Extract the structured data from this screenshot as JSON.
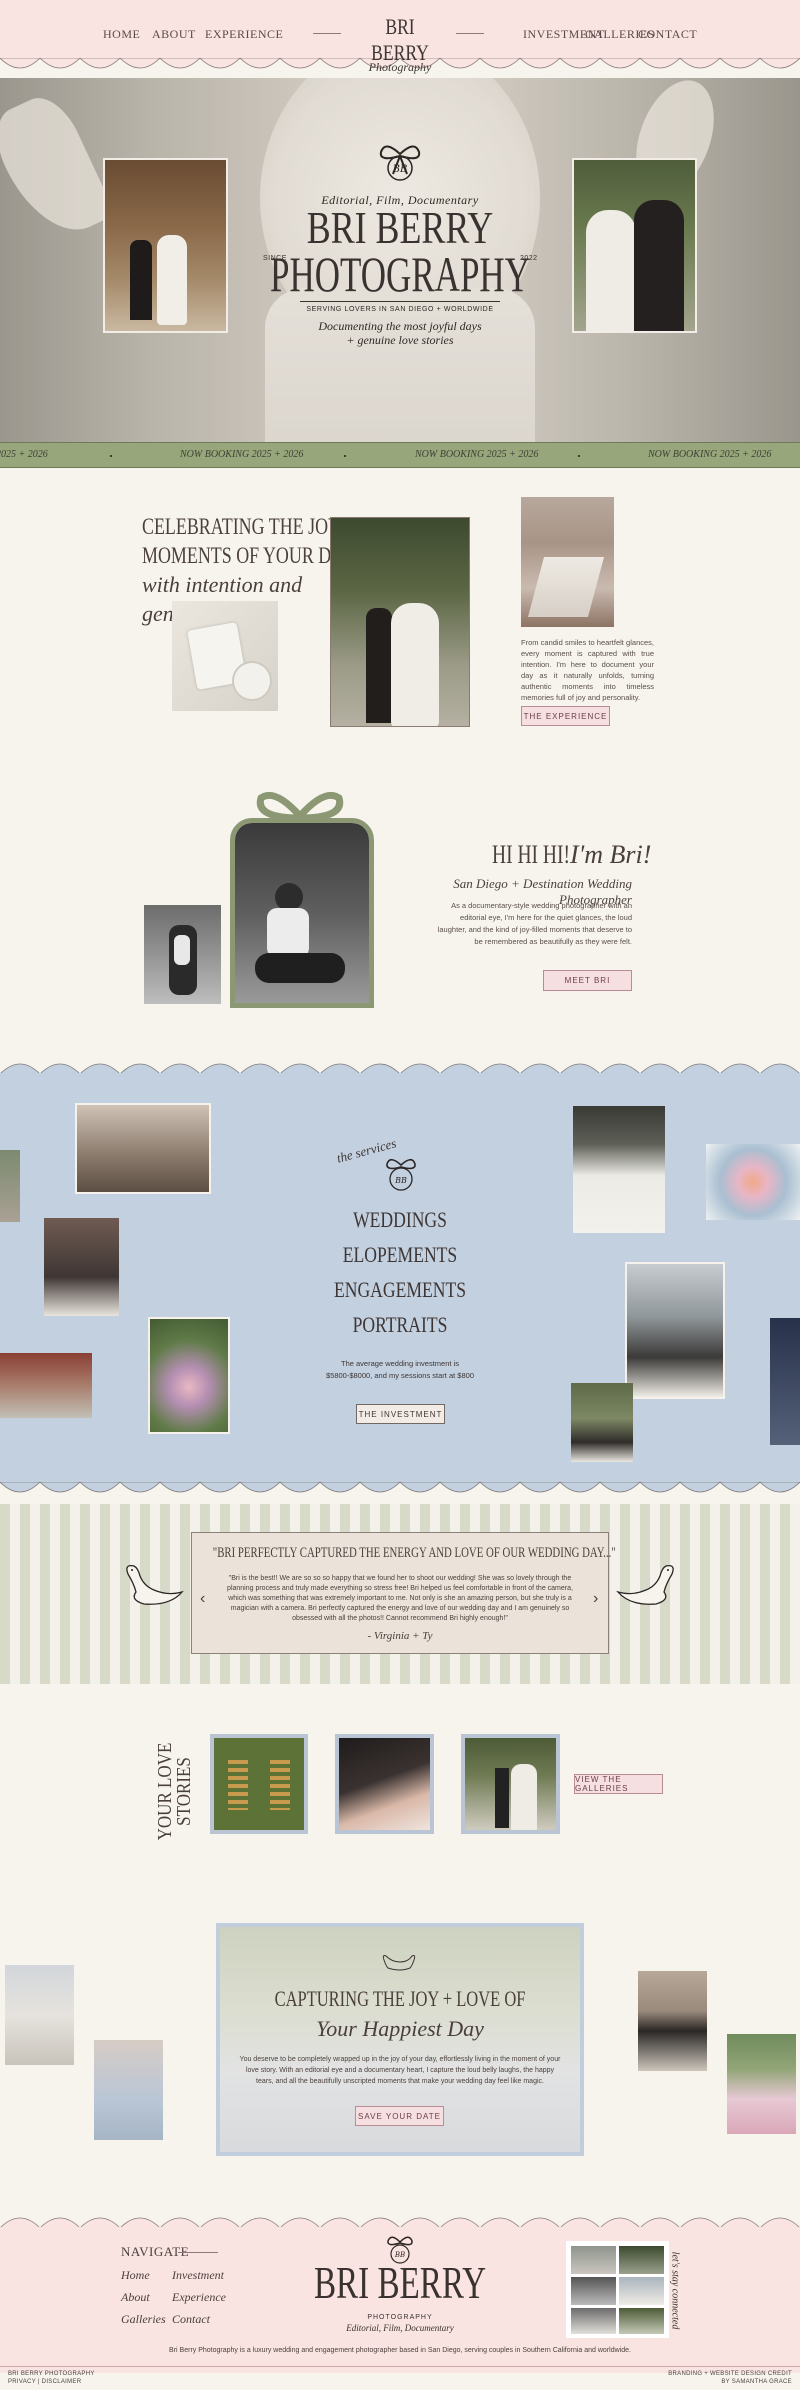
{
  "nav": {
    "left": [
      "HOME",
      "ABOUT",
      "EXPERIENCE"
    ],
    "right": [
      "INVESTMENT",
      "GALLERIES",
      "CONTACT"
    ],
    "logo_main": "BRI BERRY",
    "logo_sub": "Photography"
  },
  "hero": {
    "tagline": "Editorial, Film, Documentary",
    "title_line1": "BRI BERRY",
    "title_line2": "PHOTOGRAPHY",
    "since": "SINCE",
    "year": "2022",
    "serving": "SERVING LOVERS IN SAN DIEGO + WORLDWIDE",
    "script1": "Documenting the most joyful days",
    "script2": "+ genuine love stories"
  },
  "ticker": {
    "items": [
      "2025 + 2026",
      "NOW BOOKING 2025 + 2026",
      "NOW BOOKING 2025 + 2026",
      "NOW BOOKING 2025 + 2026"
    ]
  },
  "celebrate": {
    "line1": "CELEBRATING THE JOYFUL",
    "line2": "MOMENTS OF YOUR DAY",
    "line3": "with intention and",
    "line4": "genuine love.",
    "body": "From candid smiles to heartfelt glances, every moment is captured with true intention. I'm here to document your day as it naturally unfolds, turning authentic moments into timeless memories full of joy and personality.",
    "button": "THE EXPERIENCE"
  },
  "about": {
    "hi": "HI HI HI!",
    "im": "I'm Bri!",
    "subtitle": "San Diego + Destination Wedding Photographer",
    "body": "As a documentary-style wedding photographer with an editorial eye, I'm here for the quiet glances, the loud laughter, and the kind of joy-filled moments that deserve to be remembered as beautifully as they were felt.",
    "button": "MEET BRI"
  },
  "services": {
    "script": "the services",
    "items": [
      "WEDDINGS",
      "ELOPEMENTS",
      "ENGAGEMENTS",
      "PORTRAITS"
    ],
    "text1": "The average wedding investment is",
    "text2": "$5800-$8000, and my sessions start at $800",
    "button": "THE INVESTMENT"
  },
  "testimonial": {
    "title": "\"BRI PERFECTLY CAPTURED THE ENERGY AND LOVE OF OUR WEDDING DAY...\"",
    "body": "\"Bri is the best!! We are so so so happy that we found her to shoot our wedding! She was so lovely through the planning process and truly made everything so stress free! Bri helped us feel comfortable in front of the camera, which was something that was extremely important to me. Not only is she an amazing person, but she truly is a magician with a camera. Bri perfectly captured the energy and love of our wedding day and I am genuinely so obsessed with all the photos!! Cannot recommend Bri highly enough!\"",
    "author": "- Virginia + Ty",
    "prev": "‹",
    "next": "›"
  },
  "stories": {
    "title1": "YOUR LOVE",
    "title2": "STORIES",
    "button": "VIEW THE GALLERIES"
  },
  "cta": {
    "title1": "CAPTURING THE JOY + LOVE OF",
    "title2": "Your Happiest Day",
    "body": "You deserve to be completely wrapped up in the joy of your day, effortlessly living in the moment of your love story. With an editorial eye and a documentary heart, I capture the loud belly laughs, the happy tears, and all the beautifully unscripted moments that make your wedding day feel like magic.",
    "button": "SAVE YOUR DATE"
  },
  "footer": {
    "navigate": "NAVIGATE",
    "links_col1": [
      "Home",
      "About",
      "Galleries"
    ],
    "links_col2": [
      "Investment",
      "Experience",
      "Contact"
    ],
    "logo_main": "BRI BERRY",
    "logo_sub": "PHOTOGRAPHY",
    "logo_tag": "Editorial, Film, Documentary",
    "tagline": "Bri Berry Photography is a luxury wedding and engagement photographer based in San Diego, serving couples in Southern California and worldwide.",
    "side_script": "let's stay connected",
    "copy1": "BRI BERRY PHOTOGRAPHY",
    "copy2": "PRIVACY | DISCLAIMER",
    "credit1": "BRANDING + WEBSITE DESIGN CREDIT",
    "credit2": "BY SAMANTHA GRACE"
  },
  "colors": {
    "pink": "#f9e4e2",
    "sage": "#98a67c",
    "blue": "#c3d0e0",
    "cream": "#f7f4ee",
    "rose_text": "#6b3d4a"
  }
}
